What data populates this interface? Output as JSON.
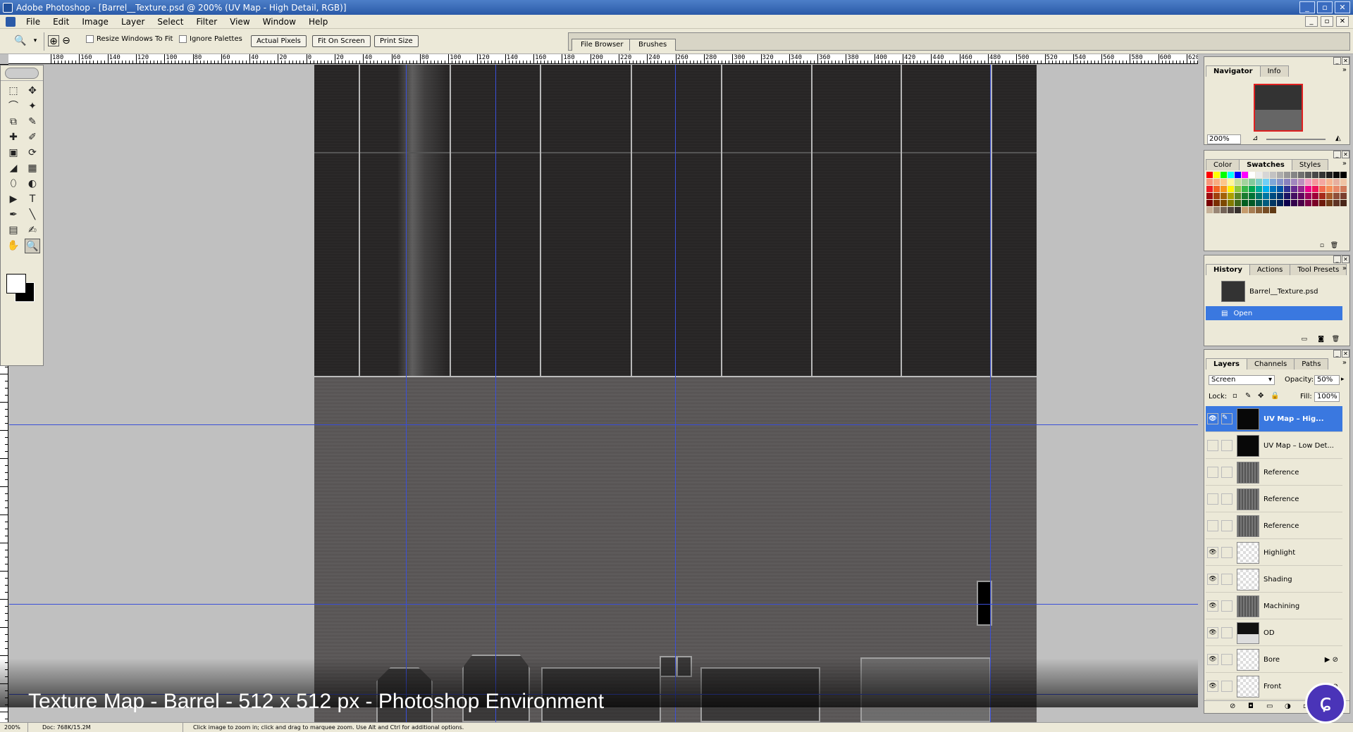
{
  "window": {
    "title": "Adobe Photoshop - [Barrel__Texture.psd @ 200% (UV Map - High Detail, RGB)]",
    "controls": [
      "_",
      "▫",
      "✕"
    ]
  },
  "menubar": {
    "items": [
      "File",
      "Edit",
      "Image",
      "Layer",
      "Select",
      "Filter",
      "View",
      "Window",
      "Help"
    ],
    "mdi_controls": [
      "_",
      "▫",
      "✕"
    ]
  },
  "options": {
    "resize_windows_label": "Resize Windows To Fit",
    "ignore_palettes_label": "Ignore Palettes",
    "actual_pixels_label": "Actual Pixels",
    "fit_on_screen_label": "Fit On Screen",
    "print_size_label": "Print Size"
  },
  "palette_well": {
    "tabs": [
      "File Browser",
      "Brushes"
    ]
  },
  "ruler": {
    "labels": [
      "180",
      "160",
      "140",
      "120",
      "100",
      "80",
      "60",
      "40",
      "20",
      "0",
      "20",
      "40",
      "60",
      "80",
      "100",
      "120",
      "140",
      "160",
      "180",
      "200",
      "220",
      "240",
      "260",
      "280",
      "300",
      "320",
      "340",
      "360",
      "380",
      "400",
      "420",
      "440",
      "460",
      "480",
      "500",
      "520",
      "540",
      "560",
      "580",
      "600",
      "620"
    ]
  },
  "tools": [
    "⬚",
    "✥",
    "⌒",
    "✦",
    "⧉",
    "✎",
    "✚",
    "✐",
    "▣",
    "⟳",
    "◢",
    "▦",
    "⬯",
    "◐",
    "▶",
    "T",
    "✒",
    "╲",
    "▤",
    "✍",
    "✋",
    "🔍"
  ],
  "navigator": {
    "tabs": [
      "Navigator",
      "Info"
    ],
    "zoom": "200%"
  },
  "color_panel": {
    "tabs": [
      "Color",
      "Swatches",
      "Styles"
    ],
    "swatches": [
      "#ff0000",
      "#ffff00",
      "#00ff00",
      "#00ffff",
      "#0000ff",
      "#ff00ff",
      "#ffffff",
      "#ebebeb",
      "#d6d6d6",
      "#c2c2c2",
      "#adadad",
      "#999999",
      "#858585",
      "#707070",
      "#5c5c5c",
      "#474747",
      "#333333",
      "#1f1f1f",
      "#0a0a0a",
      "#000000",
      "#f7977a",
      "#f9ad81",
      "#fdc68a",
      "#fff79a",
      "#c4df9b",
      "#a2d39c",
      "#82ca9d",
      "#7bcdc8",
      "#6ecff6",
      "#7ea7d8",
      "#8493ca",
      "#8882be",
      "#a187be",
      "#bc8dbf",
      "#f49ac2",
      "#f6989d",
      "#f5a7a0",
      "#f7b491",
      "#e7b0a0",
      "#f0c4a4",
      "#ed1c24",
      "#f26522",
      "#f7941d",
      "#fff200",
      "#8dc63f",
      "#39b54a",
      "#00a651",
      "#00a99d",
      "#00aeef",
      "#0072bc",
      "#0054a6",
      "#2e3192",
      "#662d91",
      "#92278f",
      "#ec008c",
      "#ed145b",
      "#f26c4f",
      "#f68e56",
      "#e8896a",
      "#d07a5a",
      "#9e0b0f",
      "#a0410d",
      "#a36209",
      "#aba000",
      "#598527",
      "#197b30",
      "#007236",
      "#00746b",
      "#0076a3",
      "#004a80",
      "#003471",
      "#1b1464",
      "#440e62",
      "#630460",
      "#9e005d",
      "#9e0039",
      "#a62b1a",
      "#a85a2a",
      "#8f4f3a",
      "#7a3e2e",
      "#790000",
      "#7b2e00",
      "#7d4900",
      "#827b00",
      "#406618",
      "#005e20",
      "#005826",
      "#005952",
      "#005b7f",
      "#003663",
      "#002157",
      "#0d004c",
      "#32004b",
      "#4b0049",
      "#7b0046",
      "#7a0026",
      "#6e1b0b",
      "#703a16",
      "#5e3324",
      "#4a2618",
      "#c7b299",
      "#998675",
      "#736357",
      "#534741",
      "#37302d",
      "#c69c6d",
      "#a67c52",
      "#8c6239",
      "#754c24",
      "#603913",
      "#ece9d8",
      "#ece9d8",
      "#ece9d8",
      "#ece9d8",
      "#ece9d8",
      "#ece9d8",
      "#ece9d8",
      "#ece9d8",
      "#ece9d8",
      "#ece9d8"
    ]
  },
  "history": {
    "tabs": [
      "History",
      "Actions",
      "Tool Presets"
    ],
    "snapshot": "Barrel__Texture.psd",
    "open_state": "Open"
  },
  "layers": {
    "tabs": [
      "Layers",
      "Channels",
      "Paths"
    ],
    "blend_mode": "Screen",
    "opacity_label": "Opacity:",
    "opacity": "50%",
    "lock_label": "Lock:",
    "fill_label": "Fill:",
    "fill": "100%",
    "items": [
      {
        "name": "UV Map – Hig...",
        "visible": true,
        "thumb": "dark",
        "selected": true
      },
      {
        "name": "UV Map – Low Det...",
        "visible": false,
        "thumb": "dark",
        "selected": false
      },
      {
        "name": "Reference",
        "visible": false,
        "thumb": "gray",
        "selected": false
      },
      {
        "name": "Reference",
        "visible": false,
        "thumb": "gray",
        "selected": false
      },
      {
        "name": "Reference",
        "visible": false,
        "thumb": "gray",
        "selected": false
      },
      {
        "name": "Highlight",
        "visible": true,
        "thumb": "checker",
        "selected": false
      },
      {
        "name": "Shading",
        "visible": true,
        "thumb": "checker",
        "selected": false
      },
      {
        "name": "Machining",
        "visible": true,
        "thumb": "gray",
        "selected": false
      },
      {
        "name": "OD",
        "visible": true,
        "thumb": "dark-checker",
        "selected": false
      },
      {
        "name": "Bore",
        "visible": true,
        "thumb": "checker",
        "selected": false,
        "fx": "▶ ⊘"
      },
      {
        "name": "Front",
        "visible": true,
        "thumb": "checker",
        "selected": false,
        "fx": "▶ ⊘"
      }
    ]
  },
  "statusbar": {
    "zoom": "200%",
    "doc": "Doc: 768K/15.2M",
    "hint": "Click image to zoom in; click and drag to marquee zoom.  Use Alt and Ctrl for additional options."
  },
  "caption": "Texture Map - Barrel - 512 x 512 px - Photoshop Environment",
  "badge": "ɕ"
}
